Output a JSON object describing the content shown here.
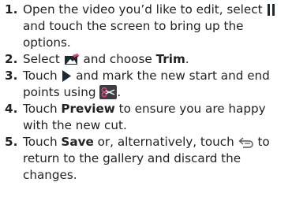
{
  "steps": [
    {
      "number": "1.",
      "text_before_icon": "Open the video you’d like to edit, select",
      "icon": "pause-icon",
      "text_after_icon": "and touch the screen to bring up the options."
    },
    {
      "number": "2.",
      "text_before_icon": "Select",
      "icon": "edit-video-icon",
      "text_middle": "and choose",
      "bold": "Trim",
      "text_end": "."
    },
    {
      "number": "3.",
      "text_before_icon": "Touch",
      "icon": "play-icon",
      "text_middle": "and mark the new start and end points using",
      "icon2": "scissors-icon",
      "text_end": "."
    },
    {
      "number": "4.",
      "text_before": "Touch",
      "bold": "Preview",
      "text_after": "to ensure you are happy with the new cut."
    },
    {
      "number": "5.",
      "text_before": "Touch",
      "bold": "Save",
      "text_middle": "or, alternatively, touch",
      "icon": "back-icon",
      "text_end": "to return to the gallery and discard the changes."
    }
  ],
  "colors": {
    "text": "#222222",
    "icon_dark": "#1e2a33",
    "icon_pink": "#e8447a"
  }
}
